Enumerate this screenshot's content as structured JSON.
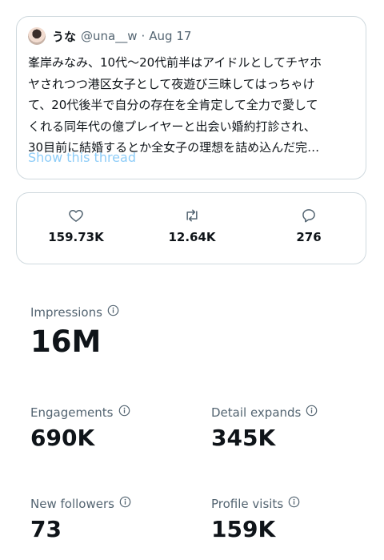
{
  "tweet": {
    "author_name": "うな",
    "handle": "@una__w",
    "separator": "·",
    "date": "Aug 17",
    "text": "峯岸みなみ、10代〜20代前半はアイドルとしてチヤホ\nヤされつつ港区女子として夜遊び三昧してはっちゃけ\nて、20代後半で自分の存在を全肯定して全力で愛して\nくれる同年代の億プレイヤーと出会い婚約打診され、\n30目前に結婚するとか全女子の理想を詰め込んだ完…",
    "show_thread_label": "Show this thread"
  },
  "metrics": {
    "likes": "159.73K",
    "retweets": "12.64K",
    "replies": "276"
  },
  "stats": {
    "impressions": {
      "label": "Impressions",
      "value": "16M"
    },
    "engagements": {
      "label": "Engagements",
      "value": "690K"
    },
    "detail_expands": {
      "label": "Detail expands",
      "value": "345K"
    },
    "new_followers": {
      "label": "New followers",
      "value": "73"
    },
    "profile_visits": {
      "label": "Profile visits",
      "value": "159K"
    }
  },
  "icons": {
    "like": "heart-icon",
    "retweet": "retweet-icon",
    "reply": "reply-icon",
    "info": "info-icon"
  },
  "colors": {
    "text": "#0f1419",
    "secondary": "#536471",
    "link": "#8ecdf8",
    "border": "#cfd9de"
  }
}
